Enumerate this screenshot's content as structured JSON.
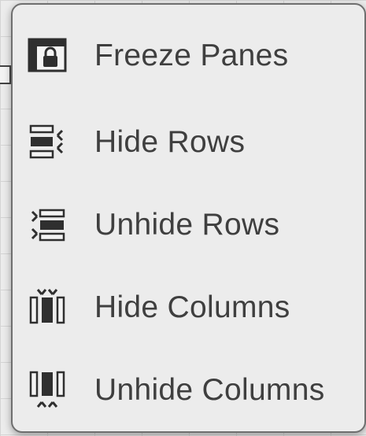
{
  "menu": {
    "items": [
      {
        "label": "Freeze Panes",
        "icon": "freeze-panes-icon"
      },
      {
        "label": "Hide Rows",
        "icon": "hide-rows-icon"
      },
      {
        "label": "Unhide Rows",
        "icon": "unhide-rows-icon"
      },
      {
        "label": "Hide Columns",
        "icon": "hide-columns-icon"
      },
      {
        "label": "Unhide Columns",
        "icon": "unhide-columns-icon"
      }
    ]
  },
  "colors": {
    "menu_background": "#ececec",
    "menu_border": "#6f6f6f",
    "label_text": "#3f3f3f",
    "icon_dark": "#2f2f2f"
  }
}
